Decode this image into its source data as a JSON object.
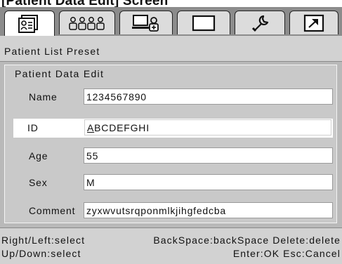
{
  "doc_heading": "[Patient Data Edit] Screen",
  "tabs": [
    {
      "icon": "patient-list-icon",
      "active": true
    },
    {
      "icon": "patients-group-icon",
      "active": false
    },
    {
      "icon": "computer-user-icon",
      "active": false
    },
    {
      "icon": "blank-screen-icon",
      "active": false
    },
    {
      "icon": "wrench-icon",
      "active": false
    },
    {
      "icon": "arrow-upright-icon",
      "active": false
    }
  ],
  "preset_label": "Patient List Preset",
  "panel": {
    "title": "Patient Data Edit",
    "fields": [
      {
        "label": "Name",
        "value": "1234567890"
      },
      {
        "label": "ID",
        "value_cursor_char": "A",
        "value_rest": "BCDEFGHI",
        "selected": true
      },
      {
        "label": "Age",
        "value": "55"
      },
      {
        "label": "Sex",
        "value": "M"
      },
      {
        "label": "Comment",
        "value": "zyxwvutsrqponmlkjihgfedcba"
      }
    ]
  },
  "status": {
    "line1_left": "Right/Left:select",
    "line1_right": "BackSpace:backSpace Delete:delete",
    "line2_left": "Up/Down:select",
    "line2_right": "Enter:OK Esc:Cancel"
  },
  "colors": {
    "screen_bg": "#b9b9b9",
    "tabbar_bg": "#8c8c8c",
    "field_bg": "#ffffff"
  }
}
